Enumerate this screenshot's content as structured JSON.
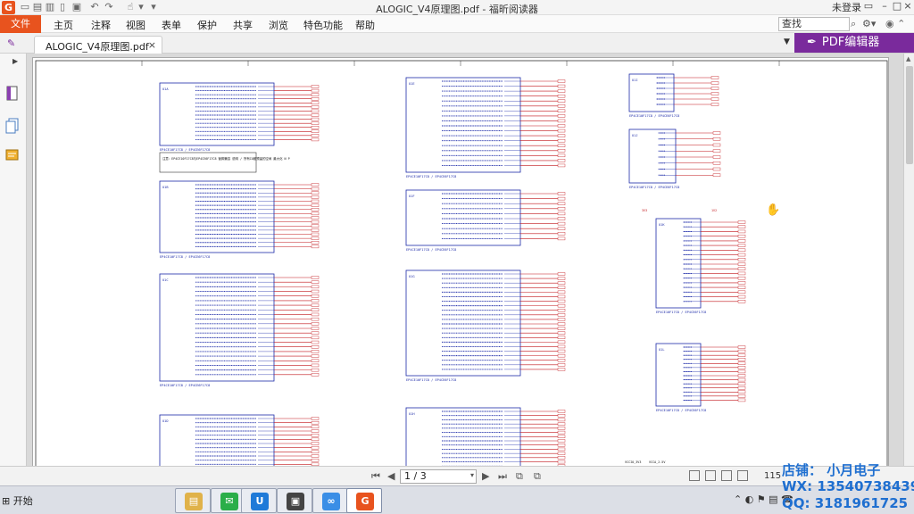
{
  "window": {
    "title": "ALOGIC_V4原理图.pdf - 福昕阅读器",
    "login_label": "未登录",
    "app_logo_letter": "G"
  },
  "menu": {
    "file": "文件",
    "items": [
      "主页",
      "注释",
      "视图",
      "表单",
      "保护",
      "共享",
      "浏览",
      "特色功能",
      "帮助"
    ],
    "search_placeholder": "查找"
  },
  "tab": {
    "label": "ALOGIC_V4原理图.pdf",
    "pdf_editor_label": "PDF编辑器"
  },
  "statusbar": {
    "page_value": "1 / 3",
    "zoom_text": "115"
  },
  "taskbar": {
    "start_label": "开始"
  },
  "watermark": {
    "shop": "店铺：  小月电子",
    "wx": "WX:   13540738439",
    "qq": "QQ:   3181961725"
  },
  "schematic": {
    "components": [
      {
        "ref": "U1A",
        "caption": "EP4CE10F17C8 / EP4CE6F17C8"
      },
      {
        "ref": "U1B",
        "caption": "EP4CE10F17C8 / EP4CE6F17C8"
      },
      {
        "ref": "U1C",
        "caption": "EP4CE10F17C8 / EP4CE6F17C8"
      },
      {
        "ref": "U1D",
        "caption": ""
      },
      {
        "ref": "U1E",
        "caption": "EP4CE10F17C8 / EP4CE6F17C8"
      },
      {
        "ref": "U1F",
        "caption": "EP4CE10F17C8 / EP4CE6F17C8"
      },
      {
        "ref": "U1G",
        "caption": "EP4CE10F17C8 / EP4CE6F17C8"
      },
      {
        "ref": "U1H",
        "caption": ""
      },
      {
        "ref": "U1I",
        "caption": "EP4CE10F17C8 / EP4CE6F17C8"
      },
      {
        "ref": "U1J",
        "caption": "EP4CE10F17C8 / EP4CE6F17C8"
      },
      {
        "ref": "U1K",
        "caption": "EP4CE10F17C8 / EP4CE6F17C8"
      },
      {
        "ref": "U1L",
        "caption": "EP4CE10F17C8 / EP4CE6F17C8"
      }
    ],
    "note": "注意：EP4CE10F17C8与EP4CE6F17C8 管脚兼容 说明 / 所有IO都预留的空间 最大化 N P",
    "rail_labels": [
      "3V3",
      "1V2",
      "VCCIO_3V3",
      "VCCA_2.5V"
    ]
  }
}
